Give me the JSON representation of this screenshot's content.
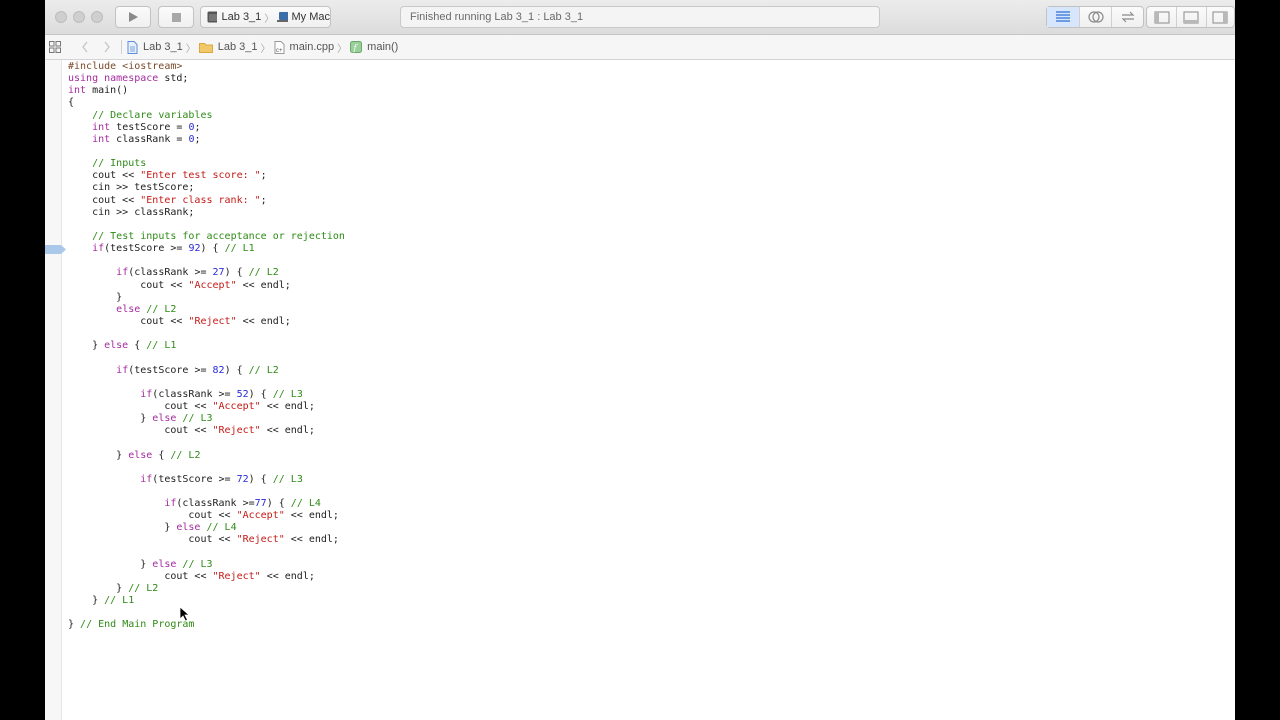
{
  "toolbar": {
    "scheme_target": "Lab 3_1",
    "scheme_device": "My Mac",
    "activity_status": "Finished running Lab 3_1 : Lab 3_1"
  },
  "jumpbar": {
    "project": "Lab 3_1",
    "group": "Lab 3_1",
    "file": "main.cpp",
    "symbol": "main()"
  },
  "editor": {
    "lines": [
      [
        [
          "pp",
          "#include <iostream>"
        ]
      ],
      [
        [
          "kw",
          "using namespace"
        ],
        [
          "tx",
          " std;"
        ]
      ],
      [
        [
          "kw",
          "int"
        ],
        [
          "tx",
          " main()"
        ]
      ],
      [
        [
          "tx",
          "{"
        ]
      ],
      [
        [
          "tx",
          "    "
        ],
        [
          "cm",
          "// Declare variables"
        ]
      ],
      [
        [
          "tx",
          "    "
        ],
        [
          "kw",
          "int"
        ],
        [
          "tx",
          " testScore = "
        ],
        [
          "num",
          "0"
        ],
        [
          "tx",
          ";"
        ]
      ],
      [
        [
          "tx",
          "    "
        ],
        [
          "kw",
          "int"
        ],
        [
          "tx",
          " classRank = "
        ],
        [
          "num",
          "0"
        ],
        [
          "tx",
          ";"
        ]
      ],
      [],
      [
        [
          "tx",
          "    "
        ],
        [
          "cm",
          "// Inputs"
        ]
      ],
      [
        [
          "tx",
          "    cout << "
        ],
        [
          "str",
          "\"Enter test score: \""
        ],
        [
          "tx",
          ";"
        ]
      ],
      [
        [
          "tx",
          "    cin >> testScore;"
        ]
      ],
      [
        [
          "tx",
          "    cout << "
        ],
        [
          "str",
          "\"Enter class rank: \""
        ],
        [
          "tx",
          ";"
        ]
      ],
      [
        [
          "tx",
          "    cin >> classRank;"
        ]
      ],
      [],
      [
        [
          "tx",
          "    "
        ],
        [
          "cm",
          "// Test inputs for acceptance or rejection"
        ]
      ],
      [
        [
          "tx",
          "    "
        ],
        [
          "kw",
          "if"
        ],
        [
          "tx",
          "(testScore >= "
        ],
        [
          "num",
          "92"
        ],
        [
          "tx",
          ") { "
        ],
        [
          "cm",
          "// L1"
        ]
      ],
      [],
      [
        [
          "tx",
          "        "
        ],
        [
          "kw",
          "if"
        ],
        [
          "tx",
          "(classRank >= "
        ],
        [
          "num",
          "27"
        ],
        [
          "tx",
          ") { "
        ],
        [
          "cm",
          "// L2"
        ]
      ],
      [
        [
          "tx",
          "            cout << "
        ],
        [
          "str",
          "\"Accept\""
        ],
        [
          "tx",
          " << endl;"
        ]
      ],
      [
        [
          "tx",
          "        }"
        ]
      ],
      [
        [
          "tx",
          "        "
        ],
        [
          "kw",
          "else"
        ],
        [
          "tx",
          " "
        ],
        [
          "cm",
          "// L2"
        ]
      ],
      [
        [
          "tx",
          "            cout << "
        ],
        [
          "str",
          "\"Reject\""
        ],
        [
          "tx",
          " << endl;"
        ]
      ],
      [],
      [
        [
          "tx",
          "    } "
        ],
        [
          "kw",
          "else"
        ],
        [
          "tx",
          " { "
        ],
        [
          "cm",
          "// L1"
        ]
      ],
      [],
      [
        [
          "tx",
          "        "
        ],
        [
          "kw",
          "if"
        ],
        [
          "tx",
          "(testScore >= "
        ],
        [
          "num",
          "82"
        ],
        [
          "tx",
          ") { "
        ],
        [
          "cm",
          "// L2"
        ]
      ],
      [],
      [
        [
          "tx",
          "            "
        ],
        [
          "kw",
          "if"
        ],
        [
          "tx",
          "(classRank >= "
        ],
        [
          "num",
          "52"
        ],
        [
          "tx",
          ") { "
        ],
        [
          "cm",
          "// L3"
        ]
      ],
      [
        [
          "tx",
          "                cout << "
        ],
        [
          "str",
          "\"Accept\""
        ],
        [
          "tx",
          " << endl;"
        ]
      ],
      [
        [
          "tx",
          "            } "
        ],
        [
          "kw",
          "else"
        ],
        [
          "tx",
          " "
        ],
        [
          "cm",
          "// L3"
        ]
      ],
      [
        [
          "tx",
          "                cout << "
        ],
        [
          "str",
          "\"Reject\""
        ],
        [
          "tx",
          " << endl;"
        ]
      ],
      [],
      [
        [
          "tx",
          "        } "
        ],
        [
          "kw",
          "else"
        ],
        [
          "tx",
          " { "
        ],
        [
          "cm",
          "// L2"
        ]
      ],
      [],
      [
        [
          "tx",
          "            "
        ],
        [
          "kw",
          "if"
        ],
        [
          "tx",
          "(testScore >= "
        ],
        [
          "num",
          "72"
        ],
        [
          "tx",
          ") { "
        ],
        [
          "cm",
          "// L3"
        ]
      ],
      [],
      [
        [
          "tx",
          "                "
        ],
        [
          "kw",
          "if"
        ],
        [
          "tx",
          "(classRank >="
        ],
        [
          "num",
          "77"
        ],
        [
          "tx",
          ") { "
        ],
        [
          "cm",
          "// L4"
        ]
      ],
      [
        [
          "tx",
          "                    cout << "
        ],
        [
          "str",
          "\"Accept\""
        ],
        [
          "tx",
          " << endl;"
        ]
      ],
      [
        [
          "tx",
          "                } "
        ],
        [
          "kw",
          "else"
        ],
        [
          "tx",
          " "
        ],
        [
          "cm",
          "// L4"
        ]
      ],
      [
        [
          "tx",
          "                    cout << "
        ],
        [
          "str",
          "\"Reject\""
        ],
        [
          "tx",
          " << endl;"
        ]
      ],
      [],
      [
        [
          "tx",
          "            } "
        ],
        [
          "kw",
          "else"
        ],
        [
          "tx",
          " "
        ],
        [
          "cm",
          "// L3"
        ]
      ],
      [
        [
          "tx",
          "                cout << "
        ],
        [
          "str",
          "\"Reject\""
        ],
        [
          "tx",
          " << endl;"
        ]
      ],
      [
        [
          "tx",
          "        } "
        ],
        [
          "cm",
          "// L2"
        ]
      ],
      [
        [
          "tx",
          "    } "
        ],
        [
          "cm",
          "// L1"
        ]
      ],
      [],
      [
        [
          "tx",
          "} "
        ],
        [
          "cm",
          "// End Main Program"
        ]
      ]
    ]
  }
}
